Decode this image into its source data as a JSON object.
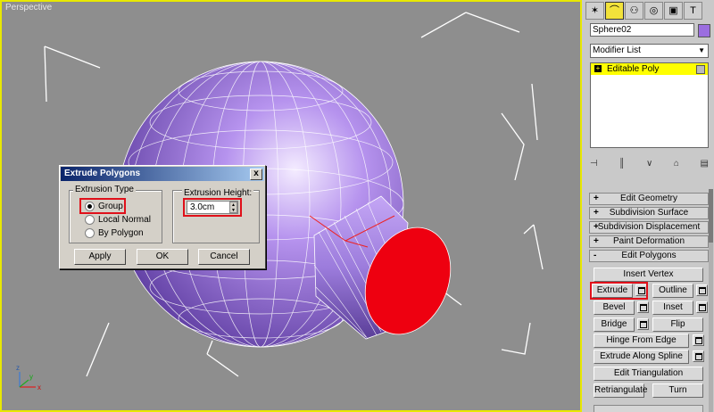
{
  "viewport": {
    "label": "Perspective",
    "axis_labels": {
      "x": "x",
      "y": "y",
      "z": "z"
    }
  },
  "dialog": {
    "title": "Extrude Polygons",
    "close_label": "x",
    "extrusion_type": {
      "label": "Extrusion Type",
      "options": [
        "Group",
        "Local Normal",
        "By Polygon"
      ],
      "selected": "Group"
    },
    "extrusion_height": {
      "label": "Extrusion Height:",
      "value": "3.0cm"
    },
    "buttons": {
      "apply": "Apply",
      "ok": "OK",
      "cancel": "Cancel"
    }
  },
  "panel": {
    "object_name": "Sphere02",
    "object_color": "#9b6ee0",
    "modifier_list": "Modifier List",
    "stack_items": [
      "Editable Poly"
    ],
    "rollouts": [
      {
        "sign": "+",
        "label": "Edit Geometry"
      },
      {
        "sign": "+",
        "label": "Subdivision Surface"
      },
      {
        "sign": "+",
        "label": "Subdivision Displacement"
      },
      {
        "sign": "+",
        "label": "Paint Deformation"
      },
      {
        "sign": "-",
        "label": "Edit Polygons"
      }
    ],
    "edit_polygons": {
      "insert_vertex": "Insert Vertex",
      "extrude": "Extrude",
      "outline": "Outline",
      "bevel": "Bevel",
      "inset": "Inset",
      "bridge": "Bridge",
      "flip": "Flip",
      "hinge_from_edge": "Hinge From Edge",
      "extrude_along_spline": "Extrude Along Spline",
      "edit_triangulation": "Edit Triangulation",
      "retriangulate": "Retriangulate",
      "turn": "Turn"
    }
  },
  "colors": {
    "viewport_border": "#e8e800",
    "sphere": "#9b6ee0",
    "selected_face": "#ee0010",
    "highlight_box": "#e0101a"
  }
}
